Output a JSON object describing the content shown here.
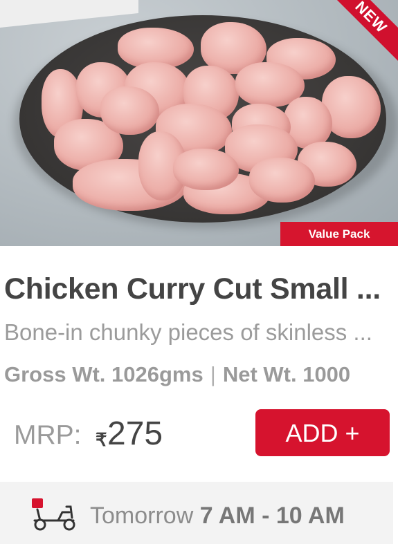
{
  "product": {
    "badge_corner": "NEW",
    "badge_pack": "Value Pack",
    "title": "Chicken Curry Cut Small ...",
    "subtitle": "Bone-in chunky pieces of skinless ...",
    "gross_label": "Gross Wt.",
    "gross_value": "1026gms",
    "separator": "|",
    "net_label": "Net Wt.",
    "net_value": "1000",
    "mrp_label": "MRP:",
    "currency": "₹",
    "price": "275",
    "add_label": "ADD +"
  },
  "delivery": {
    "icon": "scooter-icon",
    "day": "Tomorrow",
    "time": "7 AM - 10 AM"
  },
  "colors": {
    "accent": "#d6132e",
    "title": "#444444",
    "muted": "#9b9b9b"
  }
}
